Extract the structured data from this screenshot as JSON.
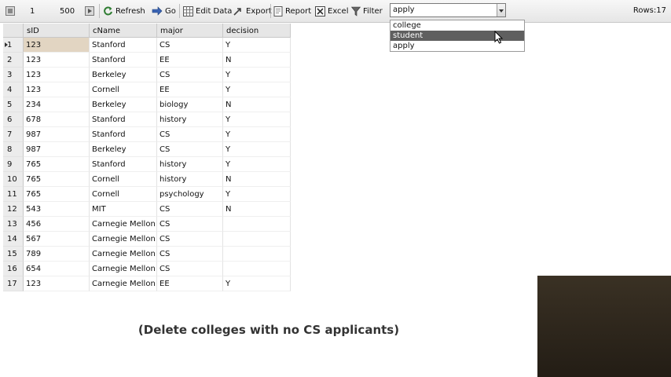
{
  "toolbar": {
    "page_start": "1",
    "page_size": "500",
    "refresh": "Refresh",
    "go": "Go",
    "edit_data": "Edit Data",
    "export": "Export",
    "report": "Report",
    "excel": "Excel",
    "filter": "Filter",
    "rows_label": "Rows:17"
  },
  "table_select": {
    "value": "apply",
    "options": [
      "college",
      "student",
      "apply"
    ],
    "highlighted": "student"
  },
  "grid": {
    "columns": [
      "sID",
      "cName",
      "major",
      "decision"
    ],
    "rows": [
      [
        "123",
        "Stanford",
        "CS",
        "Y"
      ],
      [
        "123",
        "Stanford",
        "EE",
        "N"
      ],
      [
        "123",
        "Berkeley",
        "CS",
        "Y"
      ],
      [
        "123",
        "Cornell",
        "EE",
        "Y"
      ],
      [
        "234",
        "Berkeley",
        "biology",
        "N"
      ],
      [
        "678",
        "Stanford",
        "history",
        "Y"
      ],
      [
        "987",
        "Stanford",
        "CS",
        "Y"
      ],
      [
        "987",
        "Berkeley",
        "CS",
        "Y"
      ],
      [
        "765",
        "Stanford",
        "history",
        "Y"
      ],
      [
        "765",
        "Cornell",
        "history",
        "N"
      ],
      [
        "765",
        "Cornell",
        "psychology",
        "Y"
      ],
      [
        "543",
        "MIT",
        "CS",
        "N"
      ],
      [
        "456",
        "Carnegie Mellon",
        "CS",
        ""
      ],
      [
        "567",
        "Carnegie Mellon",
        "CS",
        ""
      ],
      [
        "789",
        "Carnegie Mellon",
        "CS",
        ""
      ],
      [
        "654",
        "Carnegie Mellon",
        "CS",
        ""
      ],
      [
        "123",
        "Carnegie Mellon",
        "EE",
        "Y"
      ]
    ]
  },
  "caption": "(Delete colleges with no CS applicants)",
  "colors": {
    "selected_cell": "#e2d5c2",
    "dropdown_highlight": "#5f5f5f"
  }
}
